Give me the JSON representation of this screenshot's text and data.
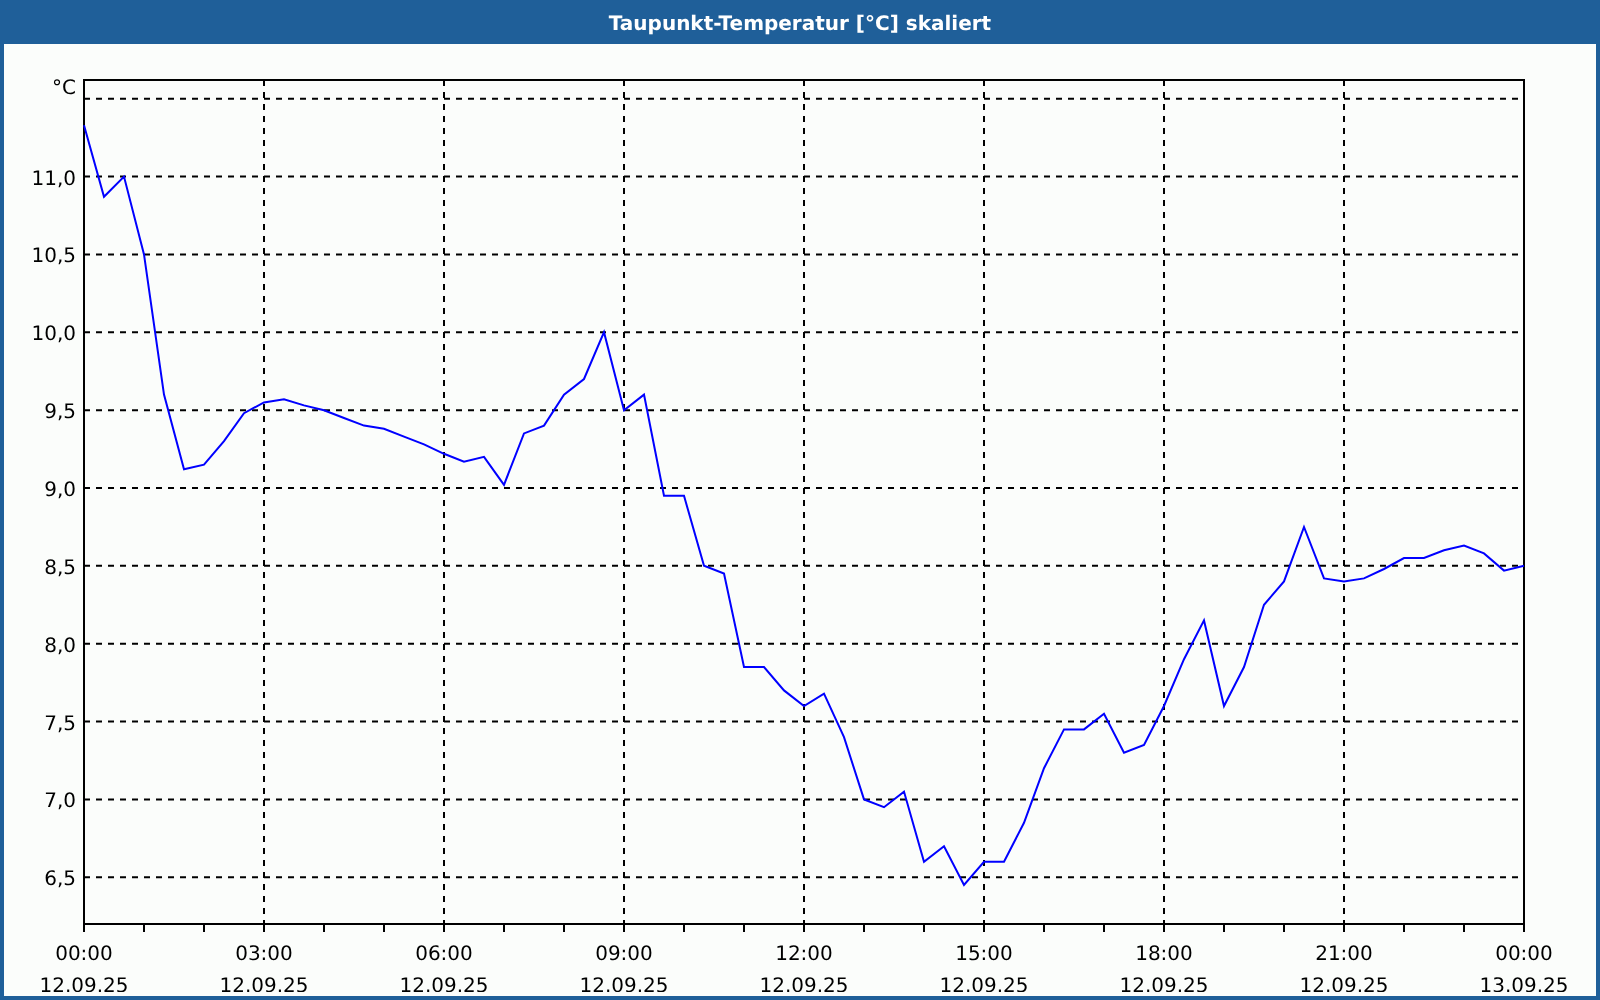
{
  "window": {
    "title": "Taupunkt-Temperatur [°C] skaliert"
  },
  "chart": {
    "chart_data": {
      "type": "line",
      "grid": true,
      "ylabel": "°C",
      "ylim": [
        6.2,
        11.62
      ],
      "categories": [
        "00:00 12.09.25",
        null,
        null,
        null,
        null,
        null,
        null,
        null,
        null,
        "03:00 12.09.25",
        null,
        null,
        null,
        null,
        null,
        null,
        null,
        null,
        "06:00 12.09.25",
        null,
        null,
        null,
        null,
        null,
        null,
        null,
        null,
        "09:00 12.09.25",
        null,
        null,
        null,
        null,
        null,
        null,
        null,
        null,
        "12:00 12.09.25",
        null,
        null,
        null,
        null,
        null,
        null,
        null,
        null,
        "15:00 12.09.25",
        null,
        null,
        null,
        null,
        null,
        null,
        null,
        null,
        "18:00 12.09.25",
        null,
        null,
        null,
        null,
        null,
        null,
        null,
        null,
        "21:00 12.09.25",
        null,
        null,
        null,
        null,
        null,
        null,
        null,
        null,
        "00:00 13.09.25"
      ],
      "yticks": [
        {
          "value": 6.5,
          "label": "6,5"
        },
        {
          "value": 7,
          "label": "7,0"
        },
        {
          "value": 7.5,
          "label": "7,5"
        },
        {
          "value": 8,
          "label": "8,0"
        },
        {
          "value": 8.5,
          "label": "8,5"
        },
        {
          "value": 9,
          "label": "9,0"
        },
        {
          "value": 9.5,
          "label": "9,5"
        },
        {
          "value": 10,
          "label": "10,0"
        },
        {
          "value": 10.5,
          "label": "10,5"
        },
        {
          "value": 11,
          "label": "11,0"
        }
      ],
      "series": [
        {
          "color": "#0000ff",
          "values": [
            11.33,
            10.87,
            11.0,
            10.5,
            9.6,
            9.12,
            9.15,
            9.3,
            9.48,
            9.55,
            9.57,
            9.53,
            9.5,
            9.45,
            9.4,
            9.38,
            9.33,
            9.28,
            9.22,
            9.17,
            9.2,
            9.02,
            9.35,
            9.4,
            9.6,
            9.7,
            10.0,
            9.5,
            9.6,
            8.95,
            8.95,
            8.5,
            8.45,
            7.85,
            7.85,
            7.7,
            7.6,
            7.68,
            7.4,
            7.0,
            6.95,
            7.05,
            6.6,
            6.7,
            6.45,
            6.6,
            6.6,
            6.85,
            7.2,
            7.45,
            7.45,
            7.55,
            7.3,
            7.35,
            7.6,
            7.9,
            8.15,
            7.6,
            7.85,
            8.25,
            8.4,
            8.75,
            8.42,
            8.4,
            8.42,
            8.48,
            8.55,
            8.55,
            8.6,
            8.63,
            8.58,
            8.47,
            8.5
          ]
        }
      ]
    }
  }
}
